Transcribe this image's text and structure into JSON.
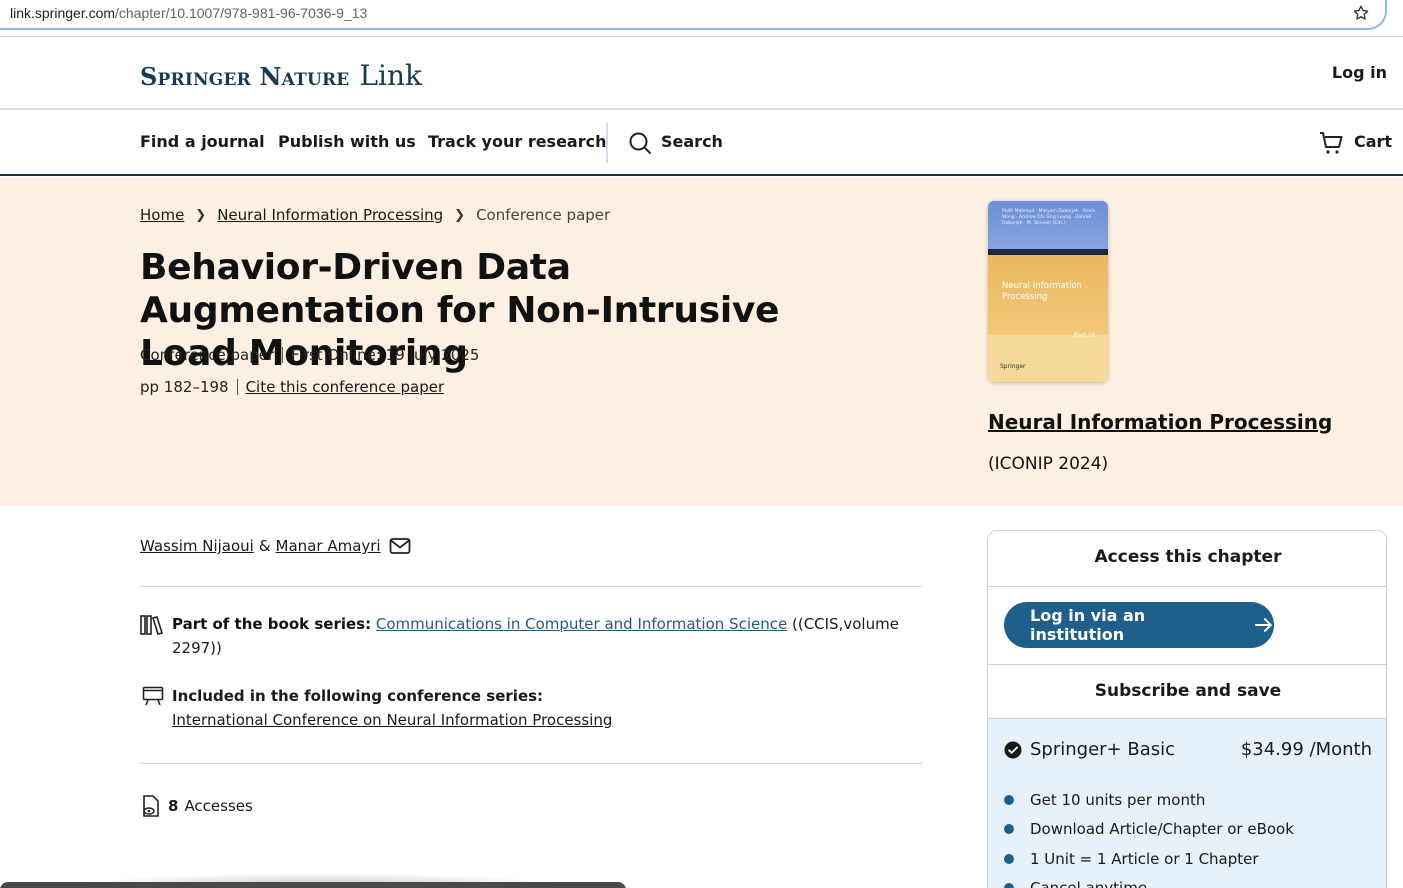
{
  "browser": {
    "url_host": "link.springer.com",
    "url_path": "/chapter/10.1007/978-981-96-7036-9_13"
  },
  "header": {
    "brand": "Springer Nature",
    "brand_suffix": "Link",
    "login_label": "Log in"
  },
  "nav": {
    "items": [
      "Find a journal",
      "Publish with us",
      "Track your research"
    ],
    "search_label": "Search",
    "cart_label": "Cart"
  },
  "breadcrumb": {
    "home": "Home",
    "book": "Neural Information Processing",
    "current": "Conference paper"
  },
  "paper": {
    "title": "Behavior-Driven Data Augmentation for Non-Intrusive Load Monitoring",
    "type": "Conference paper",
    "first_online": "First Online: 19 July 2025",
    "pages": "pp 182–198",
    "cite_label": "Cite this conference paper",
    "authors": [
      "Wassim Nijaoui",
      "Manar Amayri"
    ],
    "author_sep": "&",
    "series_label": "Part of the book series:",
    "series_name": "Communications in Computer and Information Science",
    "series_volume": "((CCIS,volume 2297))",
    "conference_label": "Included in the following conference series:",
    "conference_name": "International Conference on Neural Information Processing",
    "accesses_count": "8",
    "accesses_label": "Accesses"
  },
  "book": {
    "name": "Neural Information Processing",
    "conference": "(ICONIP 2024)",
    "cover_title": "Neural Information Processing",
    "cover_authors": "Mufti Mahmud · Maryam Doborjeh · Kevin Wong · Andrew Chi Sing Leung · Zohreh Doborjeh · M. Tanveer (Eds.)",
    "cover_part": "Part 16",
    "cover_publisher": "Springer"
  },
  "access_panel": {
    "heading": "Access this chapter",
    "institution_button": "Log in via an institution",
    "subscribe_heading": "Subscribe and save",
    "plan_name": "Springer+ Basic",
    "plan_price": "$34.99 /Month",
    "features": [
      "Get 10 units per month",
      "Download Article/Chapter or eBook",
      "1 Unit = 1 Article or 1 Chapter",
      "Cancel anytime"
    ]
  },
  "colors": {
    "hero_bg": "#fdf0e2",
    "brand_navy": "#173b4f",
    "button_blue": "#1f5f8b",
    "series_link": "#1a5e8a",
    "subscribe_bg": "#e6f1f9"
  }
}
